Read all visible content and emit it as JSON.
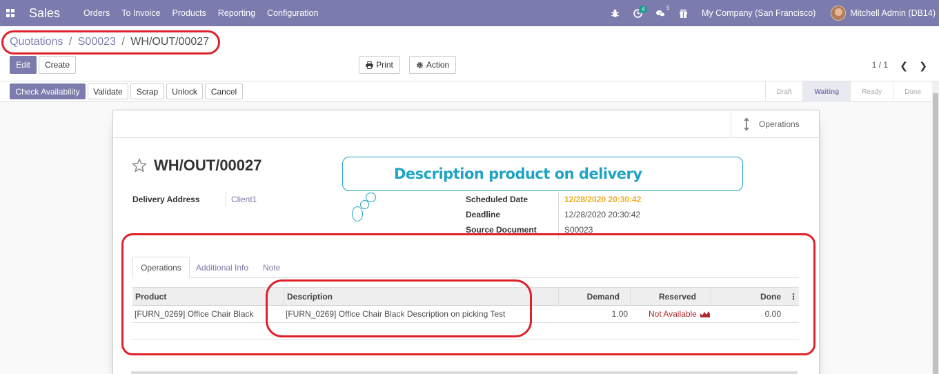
{
  "navbar": {
    "app_name": "Sales",
    "menu": [
      "Orders",
      "To Invoice",
      "Products",
      "Reporting",
      "Configuration"
    ],
    "activity_count": "4",
    "message_count": "5",
    "company": "My Company (San Francisco)",
    "user": "Mitchell Admin (DB14)",
    "color": "#7c7bad"
  },
  "breadcrumb": {
    "parts": [
      "Quotations",
      "S00023",
      "WH/OUT/00027"
    ],
    "separator": "/"
  },
  "buttons": {
    "edit": "Edit",
    "create": "Create",
    "print": "Print",
    "action": "Action"
  },
  "pager": {
    "value": "1 / 1"
  },
  "status_buttons": {
    "check_availability": "Check Availability",
    "validate": "Validate",
    "scrap": "Scrap",
    "unlock": "Unlock",
    "cancel": "Cancel"
  },
  "stages": [
    {
      "label": "Draft",
      "active": false
    },
    {
      "label": "Waiting",
      "active": true
    },
    {
      "label": "Ready",
      "active": false
    },
    {
      "label": "Done",
      "active": false
    }
  ],
  "smart_button": {
    "label": "Operations"
  },
  "record": {
    "title": "WH/OUT/00027",
    "delivery_address_label": "Delivery Address",
    "delivery_address": "Client1",
    "scheduled_date_label": "Scheduled Date",
    "scheduled_date": "12/28/2020 20:30:42",
    "deadline_label": "Deadline",
    "deadline": "12/28/2020 20:30:42",
    "source_document_label": "Source Document",
    "source_document": "S00023"
  },
  "tabs": [
    "Operations",
    "Additional Info",
    "Note"
  ],
  "table": {
    "headers": {
      "product": "Product",
      "description": "Description",
      "demand": "Demand",
      "reserved": "Reserved",
      "done": "Done"
    },
    "rows": [
      {
        "product": "[FURN_0269] Office Chair Black",
        "description": "[FURN_0269] Office Chair Black Description on picking Test",
        "demand": "1.00",
        "reserved": "Not Available",
        "done": "0.00"
      }
    ]
  },
  "annotation": {
    "callout_text": "Description product on delivery",
    "highlight_color": "#e0202a",
    "callout_color": "#1fa3c4"
  }
}
